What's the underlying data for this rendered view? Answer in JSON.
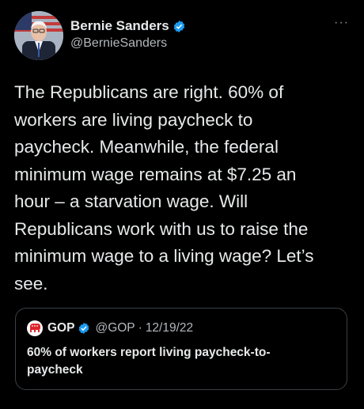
{
  "author": {
    "name": "Bernie Sanders",
    "handle": "@BernieSanders",
    "verified_color": "#1d9bf0",
    "avatar_icon": "portrait-avatar"
  },
  "menu": {
    "more_label": "···"
  },
  "tweet": {
    "text": "The Republicans are right. 60% of\nworkers are living paycheck to\npaycheck. Meanwhile, the federal\nminimum wage remains at $7.25 an\nhour – a starvation wage. Will\nRepublicans work with us to raise the\nminimum wage to a living wage? Let’s\nsee."
  },
  "quoted_tweet": {
    "name": "GOP",
    "handle": "@GOP",
    "separator": "·",
    "date": "12/19/22",
    "text": "60% of workers report living paycheck-to-\npaycheck",
    "logo_icon": "elephant-logo",
    "logo_color": "#e0242b"
  }
}
